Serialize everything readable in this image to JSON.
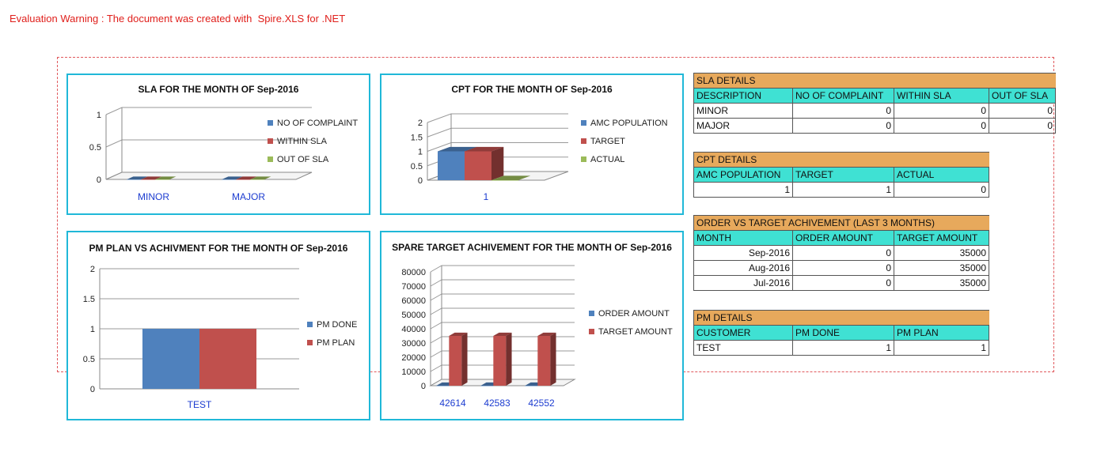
{
  "warning": "Evaluation Warning : The document was created with  Spire.XLS for .NET",
  "colors": {
    "blue": "#4f81bd",
    "red": "#c0504d",
    "green": "#9bbb59",
    "header": "#e7a95c",
    "colhdr": "#3fe1d3",
    "frame": "#20b8d8"
  },
  "chart_data": [
    {
      "type": "bar",
      "title": "SLA FOR THE MONTH OF Sep-2016",
      "categories": [
        "MINOR",
        "MAJOR"
      ],
      "series": [
        {
          "name": "NO OF COMPLAINT",
          "values": [
            0,
            0
          ]
        },
        {
          "name": "WITHIN SLA",
          "values": [
            0,
            0
          ]
        },
        {
          "name": "OUT OF SLA",
          "values": [
            0,
            0
          ]
        }
      ],
      "ylim": [
        0,
        1
      ],
      "yticks": [
        "0",
        "0.5",
        "1"
      ],
      "legend": "right"
    },
    {
      "type": "bar",
      "title": "CPT FOR THE MONTH OF Sep-2016",
      "categories": [
        "1"
      ],
      "series": [
        {
          "name": "AMC POPULATION",
          "values": [
            1
          ]
        },
        {
          "name": "TARGET",
          "values": [
            1
          ]
        },
        {
          "name": "ACTUAL",
          "values": [
            0
          ]
        }
      ],
      "ylim": [
        0,
        2
      ],
      "yticks": [
        "0",
        "0.5",
        "1",
        "1.5",
        "2"
      ],
      "legend": "right"
    },
    {
      "type": "bar",
      "title": "PM PLAN VS ACHIVMENT FOR THE MONTH OF Sep-2016",
      "categories": [
        "TEST"
      ],
      "series": [
        {
          "name": "PM DONE",
          "values": [
            1
          ]
        },
        {
          "name": "PM PLAN",
          "values": [
            1
          ]
        }
      ],
      "ylim": [
        0,
        2
      ],
      "yticks": [
        "0",
        "0.5",
        "1",
        "1.5",
        "2"
      ],
      "legend": "right"
    },
    {
      "type": "bar",
      "title": "SPARE TARGET ACHIVEMENT FOR THE MONTH OF Sep-2016",
      "categories": [
        "42614",
        "42583",
        "42552"
      ],
      "series": [
        {
          "name": "ORDER AMOUNT",
          "values": [
            0,
            0,
            0
          ]
        },
        {
          "name": "TARGET AMOUNT",
          "values": [
            35000,
            35000,
            35000
          ]
        }
      ],
      "ylim": [
        0,
        80000
      ],
      "yticks": [
        "0",
        "10000",
        "20000",
        "30000",
        "40000",
        "50000",
        "60000",
        "70000",
        "80000"
      ],
      "legend": "right"
    }
  ],
  "tables": {
    "sla": {
      "title": "SLA DETAILS",
      "headers": [
        "DESCRIPTION",
        "NO OF COMPLAINT",
        "WITHIN SLA",
        "OUT OF SLA"
      ],
      "rows": [
        [
          "MINOR",
          "0",
          "0",
          "0"
        ],
        [
          "MAJOR",
          "0",
          "0",
          "0"
        ]
      ]
    },
    "cpt": {
      "title": "CPT DETAILS",
      "headers": [
        "AMC POPULATION",
        "TARGET",
        "ACTUAL"
      ],
      "rows": [
        [
          "1",
          "1",
          "0"
        ]
      ]
    },
    "order": {
      "title": "ORDER VS TARGET ACHIVEMENT (LAST 3 MONTHS)",
      "headers": [
        "MONTH",
        "ORDER AMOUNT",
        "TARGET AMOUNT"
      ],
      "rows": [
        [
          "Sep-2016",
          "0",
          "35000"
        ],
        [
          "Aug-2016",
          "0",
          "35000"
        ],
        [
          "Jul-2016",
          "0",
          "35000"
        ]
      ]
    },
    "pm": {
      "title": "PM DETAILS",
      "headers": [
        "CUSTOMER",
        "PM DONE",
        "PM PLAN"
      ],
      "rows": [
        [
          "TEST",
          "1",
          "1"
        ]
      ]
    }
  }
}
